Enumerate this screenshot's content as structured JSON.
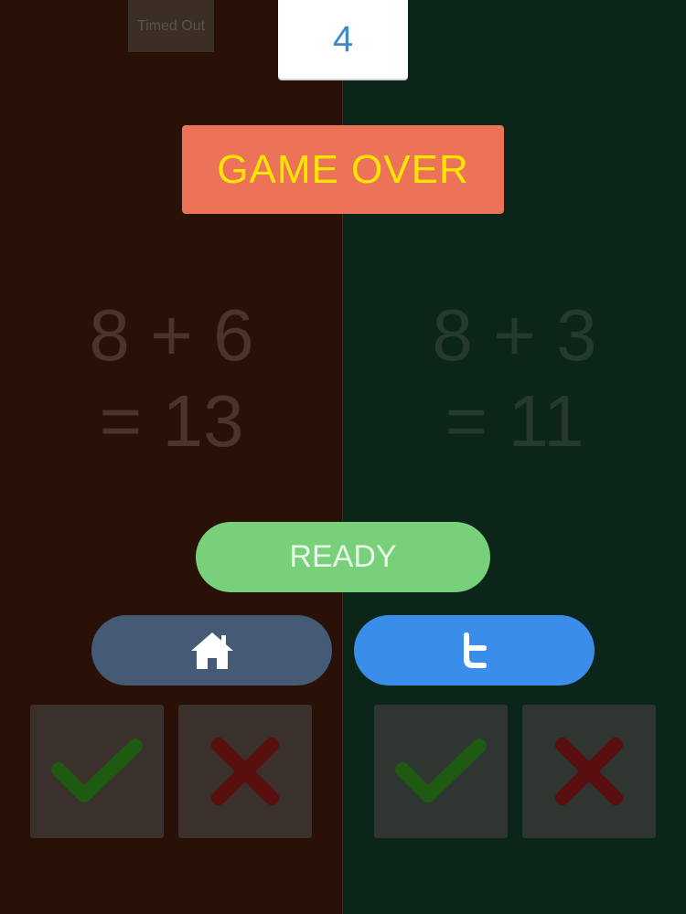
{
  "hud": {
    "timed_out_label": "Timed Out",
    "score": "4"
  },
  "banner": {
    "game_over_label": "GAME OVER"
  },
  "left": {
    "equation_line1": "8 + 6",
    "equation_line2": "= 13"
  },
  "right": {
    "equation_line1": "8 + 3",
    "equation_line2": "= 11"
  },
  "buttons": {
    "ready_label": "READY"
  },
  "icons": {
    "home": "home-icon",
    "twitter": "twitter-icon",
    "check": "check-icon",
    "cross": "cross-icon"
  },
  "colors": {
    "left_panel": "#2a1108",
    "right_panel": "#0b2518",
    "game_over_bg": "#ec7258",
    "game_over_text": "#ffe500",
    "ready": "#78d17a",
    "home": "#455a75",
    "twitter": "#3a8eea",
    "check": "#1f5a12",
    "cross": "#5a0f0f"
  }
}
